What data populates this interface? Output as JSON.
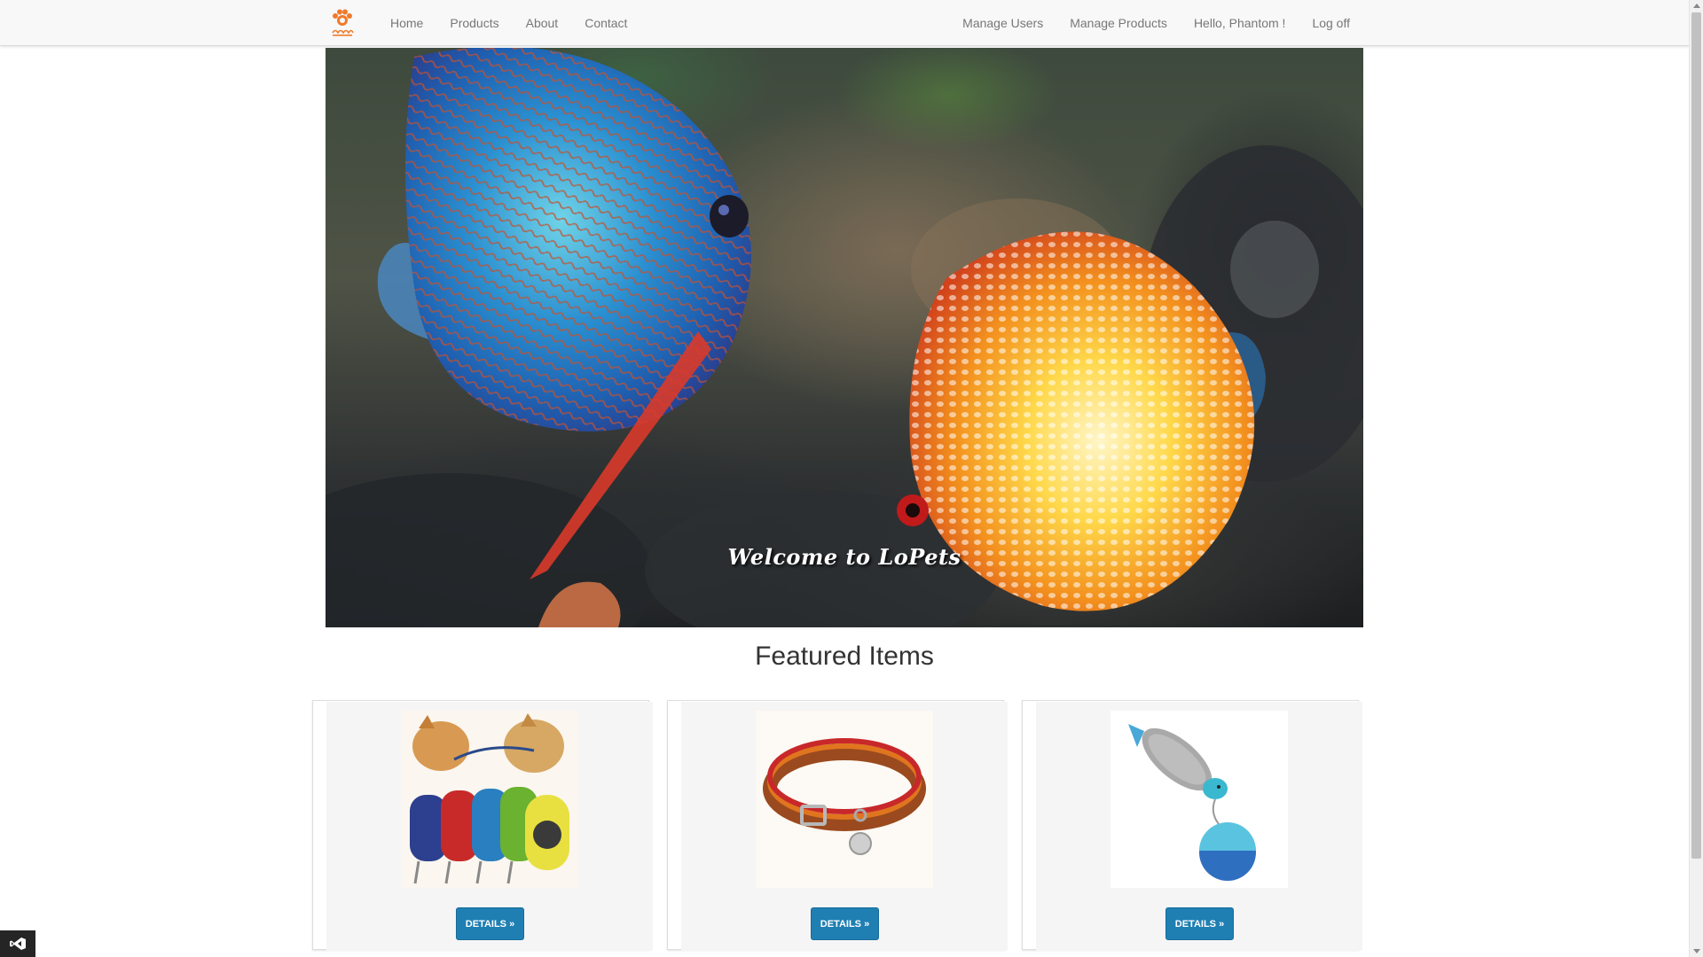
{
  "nav": {
    "brand_icon": "paw-icon",
    "left": [
      {
        "label": "Home"
      },
      {
        "label": "Products"
      },
      {
        "label": "About"
      },
      {
        "label": "Contact"
      }
    ],
    "right": [
      {
        "label": "Manage Users"
      },
      {
        "label": "Manage Products"
      },
      {
        "label": "Hello, Phantom !"
      },
      {
        "label": "Log off"
      }
    ]
  },
  "hero": {
    "caption": "Welcome to LoPets",
    "image": "discus-fish-aquarium"
  },
  "featured": {
    "title": "Featured Items",
    "items": [
      {
        "image": "retractable-dog-leashes",
        "button": "DETAILS »"
      },
      {
        "image": "leather-dog-collar",
        "button": "DETAILS »"
      },
      {
        "image": "fish-cat-toy-ball",
        "button": "DETAILS »"
      }
    ]
  },
  "colors": {
    "primary_button": "#1f7fb3",
    "brand": "#f07a2a",
    "navbar": "#f8f8f8"
  },
  "taskbar": {
    "icon": "visual-studio-icon"
  }
}
